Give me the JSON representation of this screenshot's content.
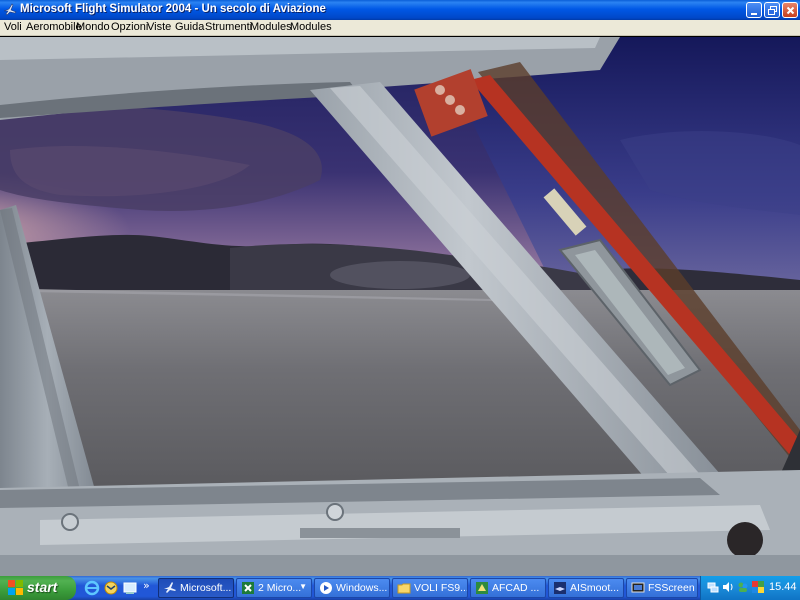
{
  "window": {
    "title": "Microsoft Flight Simulator 2004 - Un secolo di Aviazione"
  },
  "menubar": {
    "items": [
      {
        "label": "Voli"
      },
      {
        "label": "Aeromobile"
      },
      {
        "label": "Mondo"
      },
      {
        "label": "Opzioni"
      },
      {
        "label": "Viste"
      },
      {
        "label": "Guida"
      },
      {
        "label": "Strumenti"
      },
      {
        "label": "Modules"
      },
      {
        "label": "Modules"
      }
    ]
  },
  "colors": {
    "titlebar": "#0058e6",
    "menubar": "#ece9d8",
    "sky_top": "#2a2c6e",
    "sky_low": "#b49bb8",
    "water": "#6e6e72",
    "frame": "#9ea6ae",
    "taskbar": "#2157d7",
    "start": "#3c9e3c"
  },
  "taskbar": {
    "start_label": "start",
    "quicklaunch": [
      {
        "icon": "internet-explorer-icon"
      },
      {
        "icon": "outlook-express-icon"
      },
      {
        "icon": "show-desktop-icon"
      }
    ],
    "overflow": "»",
    "tasks": [
      {
        "label": "Microsoft...",
        "icon": "flight-sim-icon",
        "active": true
      },
      {
        "label": "2 Micro...",
        "icon": "excel-icon",
        "active": false
      },
      {
        "label": "Windows...",
        "icon": "media-player-icon",
        "active": false
      },
      {
        "label": "VOLI FS9...",
        "icon": "folder-icon",
        "active": false
      },
      {
        "label": "AFCAD ...",
        "icon": "afcad-icon",
        "active": false
      },
      {
        "label": "AISmoot...",
        "icon": "aismooth-icon",
        "active": false
      },
      {
        "label": "FSScreen",
        "icon": "fsscreen-icon",
        "active": false
      }
    ],
    "tray": {
      "clock": "15.44",
      "icons": [
        "network-icon",
        "volume-icon",
        "messenger-icon",
        "security-icon"
      ]
    }
  }
}
